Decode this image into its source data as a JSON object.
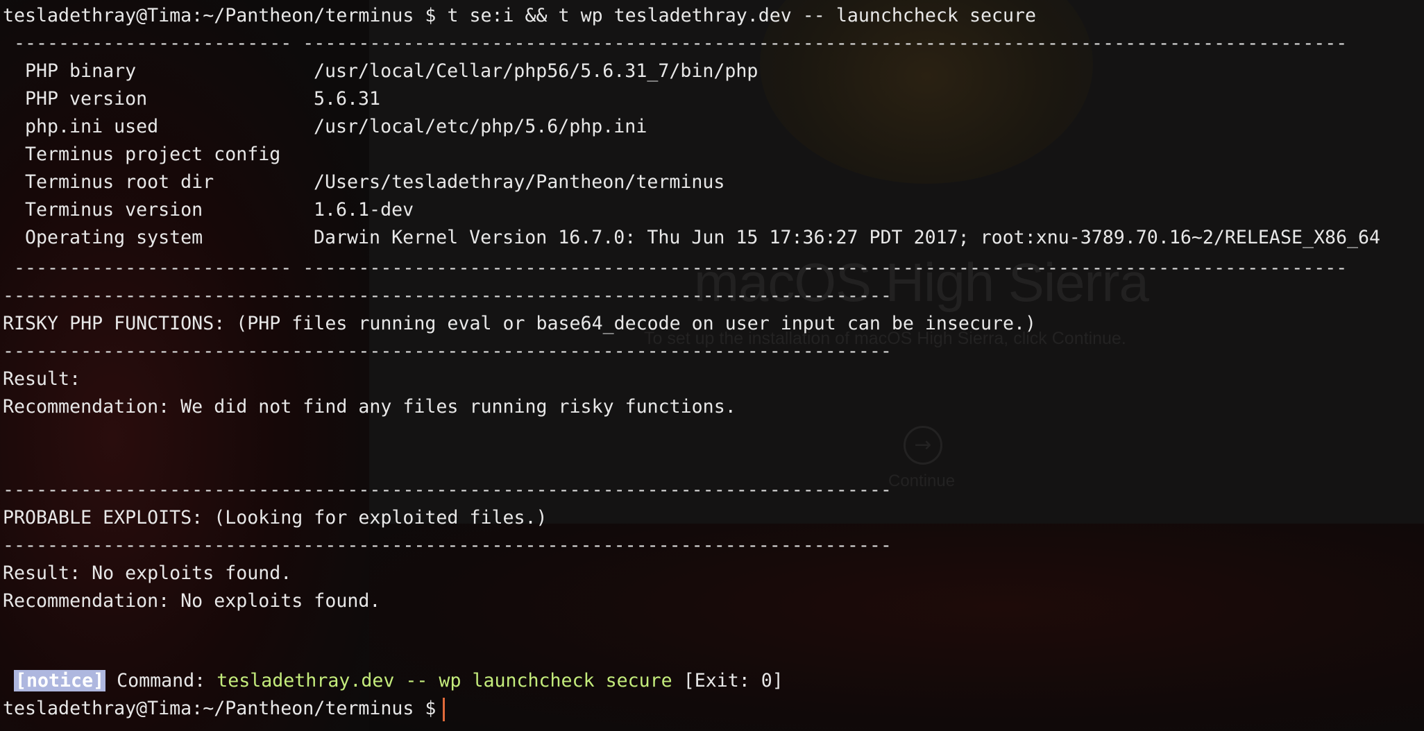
{
  "prompt": "tesladethray@Tima:~/Pantheon/terminus $",
  "command": "t se:i && t wp tesladethray.dev -- launchcheck secure",
  "separator_table": " ------------------------- ---------------------------------------------------------------------------------------------- ",
  "separator_section": "--------------------------------------------------------------------------------",
  "info_rows": [
    {
      "label": "PHP binary",
      "value": "/usr/local/Cellar/php56/5.6.31_7/bin/php"
    },
    {
      "label": "PHP version",
      "value": "5.6.31"
    },
    {
      "label": "php.ini used",
      "value": "/usr/local/etc/php/5.6/php.ini"
    },
    {
      "label": "Terminus project config",
      "value": ""
    },
    {
      "label": "Terminus root dir",
      "value": "/Users/tesladethray/Pantheon/terminus"
    },
    {
      "label": "Terminus version",
      "value": "1.6.1-dev"
    },
    {
      "label": "Operating system",
      "value": "Darwin Kernel Version 16.7.0: Thu Jun 15 17:36:27 PDT 2017; root:xnu-3789.70.16~2/RELEASE_X86_64"
    }
  ],
  "risky": {
    "heading": "RISKY PHP FUNCTIONS: (PHP files running eval or base64_decode on user input can be insecure.)",
    "result": "Result:",
    "recommendation": "Recommendation: We did not find any files running risky functions."
  },
  "exploits": {
    "heading": "PROBABLE EXPLOITS: (Looking for exploited files.)",
    "result": "Result: No exploits found.",
    "recommendation": "Recommendation: No exploits found."
  },
  "notice": {
    "tag": "[notice]",
    "label": "Command:",
    "command": "tesladethray.dev -- wp launchcheck secure",
    "exit": "[Exit: 0]"
  },
  "background": {
    "title": "macOS High Sierra",
    "subtitle": "To set up the installation of macOS High Sierra, click Continue.",
    "continue_icon": "arrow-right-circle-icon",
    "continue_label": "Continue"
  },
  "colors": {
    "text": "#e8e8e8",
    "green": "#c4ec7c",
    "notice_bg": "#aeb7df",
    "cursor": "#e06a3a"
  }
}
